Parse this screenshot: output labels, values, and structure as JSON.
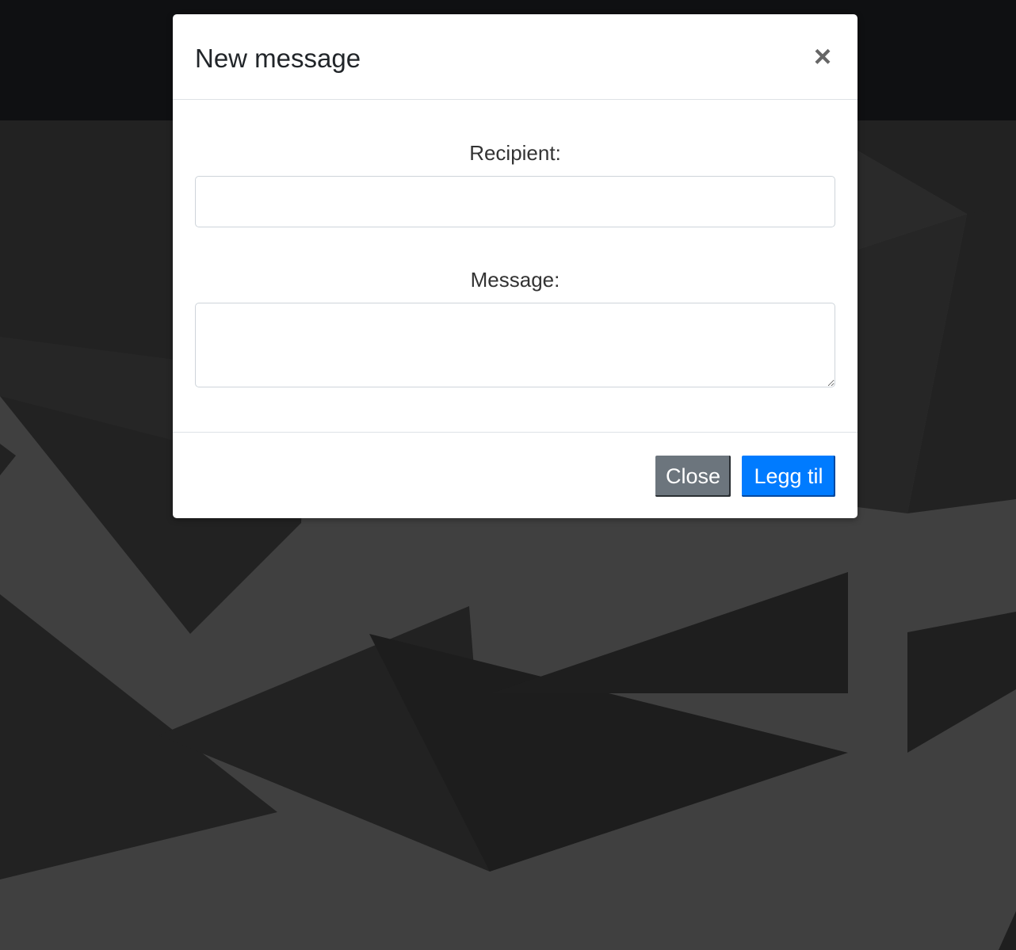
{
  "modal": {
    "title": "New message",
    "close_icon": "×",
    "recipient_label": "Recipient:",
    "recipient_value": "",
    "message_label": "Message:",
    "message_value": "",
    "close_button": "Close",
    "submit_button": "Legg til"
  },
  "colors": {
    "primary": "#007bff",
    "secondary": "#6c757d",
    "background": "#404040",
    "topbar": "#0f1012"
  }
}
